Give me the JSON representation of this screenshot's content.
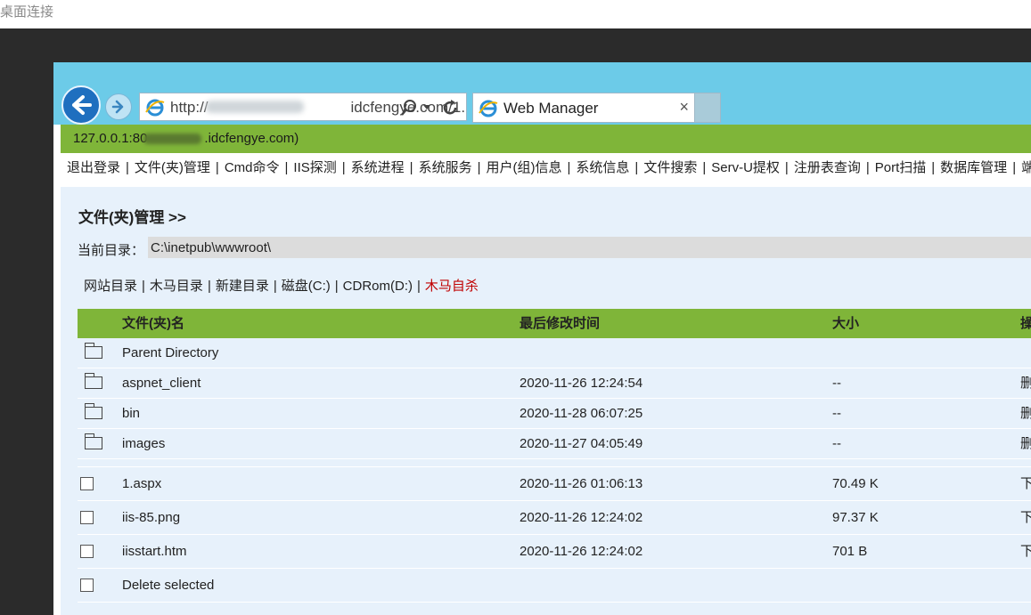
{
  "remote_desktop": {
    "title": "桌面连接"
  },
  "browser": {
    "address_prefix": "http://",
    "address_mid": "idcfengye.com/1.",
    "tab_title": "Web Manager",
    "tab_close": "×"
  },
  "page": {
    "host_prefix": "127.0.0.1:80",
    "host_suffix": ".idcfengye.com)",
    "menu": [
      "退出登录",
      "文件(夹)管理",
      "Cmd命令",
      "IIS探测",
      "系统进程",
      "系统服务",
      "用户(组)信息",
      "系统信息",
      "文件搜索",
      "Serv-U提权",
      "注册表查询",
      "Port扫描",
      "数据库管理",
      "端口"
    ],
    "section_title": "文件(夹)管理 >>",
    "current_dir_label": "当前目录：",
    "current_dir_value": "C:\\inetpub\\wwwroot\\",
    "quick_links": [
      "网站目录",
      "木马目录",
      "新建目录",
      "磁盘(C:)",
      "CDRom(D:)"
    ],
    "quick_danger": "木马自杀",
    "table": {
      "headers": {
        "name": "文件(夹)名",
        "date": "最后修改时间",
        "size": "大小",
        "op": "操"
      },
      "folders": [
        {
          "name": "Parent Directory",
          "date": "",
          "size": "",
          "op": ""
        },
        {
          "name": "aspnet_client",
          "date": "2020-11-26 12:24:54",
          "size": "--",
          "op": "删"
        },
        {
          "name": "bin",
          "date": "2020-11-28 06:07:25",
          "size": "--",
          "op": "删"
        },
        {
          "name": "images",
          "date": "2020-11-27 04:05:49",
          "size": "--",
          "op": "删"
        }
      ],
      "files": [
        {
          "name": "1.aspx",
          "date": "2020-11-26 01:06:13",
          "size": "70.49 K",
          "op": "下"
        },
        {
          "name": "iis-85.png",
          "date": "2020-11-26 12:24:02",
          "size": "97.37 K",
          "op": "下"
        },
        {
          "name": "iisstart.htm",
          "date": "2020-11-26 12:24:02",
          "size": "701 B",
          "op": "下"
        }
      ],
      "delete_selected": "Delete selected"
    }
  }
}
